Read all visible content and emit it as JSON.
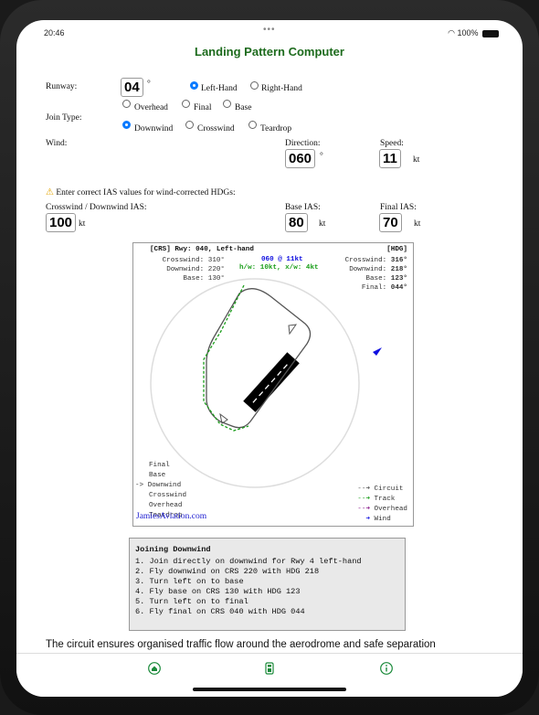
{
  "status": {
    "time": "20:46",
    "dots": "•••",
    "battery": "100%"
  },
  "title": "Landing Pattern Computer",
  "runway": {
    "label": "Runway:",
    "value": "04",
    "unit": "°",
    "options": [
      "Left-Hand",
      "Right-Hand"
    ],
    "selected": "Left-Hand"
  },
  "join": {
    "label": "Join Type:",
    "options": [
      "Overhead",
      "Final",
      "Base",
      "Downwind",
      "Crosswind",
      "Teardrop"
    ],
    "selected": "Downwind"
  },
  "wind": {
    "label": "Wind:",
    "direction_label": "Direction:",
    "direction": "060",
    "direction_unit": "°",
    "speed_label": "Speed:",
    "speed": "11",
    "speed_unit": "kt"
  },
  "ias": {
    "warning": "Enter correct IAS values for wind-corrected HDGs:",
    "crosswind_label": "Crosswind / Downwind IAS:",
    "crosswind": "100",
    "crosswind_unit": "kt",
    "base_label": "Base IAS:",
    "base": "80",
    "base_unit": "kt",
    "final_label": "Final IAS:",
    "final": "70",
    "final_unit": "kt"
  },
  "diagram": {
    "crs_header": "[CRS] Rwy: 040, Left-hand",
    "hdg_header": "[HDG]",
    "crs_rows": [
      [
        "Crosswind:",
        "310°"
      ],
      [
        "Downwind:",
        "220°"
      ],
      [
        "Base:",
        "130°"
      ]
    ],
    "hdg_rows": [
      [
        "Crosswind:",
        "316°"
      ],
      [
        "Downwind:",
        "218°"
      ],
      [
        "Base:",
        "123°"
      ],
      [
        "Final:",
        "044°"
      ]
    ],
    "wind_text": "060 @ 11kt",
    "wind_components": "h/w: 10kt, x/w: 4kt",
    "join_list": [
      "Final",
      "Base",
      "Downwind",
      "Crosswind",
      "Overhead",
      "Teardrop"
    ],
    "join_selected": "Downwind",
    "join_marker": "->",
    "legend": [
      "Circuit",
      "Track",
      "Overhead",
      "Wind"
    ],
    "credit": "JamiesAviation.com",
    "colors": {
      "circuit": "#555555",
      "track": "#1a9e1a",
      "overhead": "#8a1a8a",
      "wind": "#1010e0"
    }
  },
  "instructions": {
    "heading": "Joining Downwind",
    "lines": [
      "1. Join directly on downwind for Rwy 4 left-hand",
      "2. Fly downwind on CRS 220 with HDG 218",
      "3. Turn left on to base",
      "4. Fly base on CRS 130 with HDG 123",
      "5. Turn left on to final",
      "6. Fly final on CRS 040 with HDG 044"
    ]
  },
  "footer_text": "The circuit ensures organised traffic flow around the aerodrome and safe separation",
  "tabs": [
    {
      "icon": "home-icon"
    },
    {
      "icon": "phone-calculator-icon"
    },
    {
      "icon": "info-icon"
    }
  ]
}
